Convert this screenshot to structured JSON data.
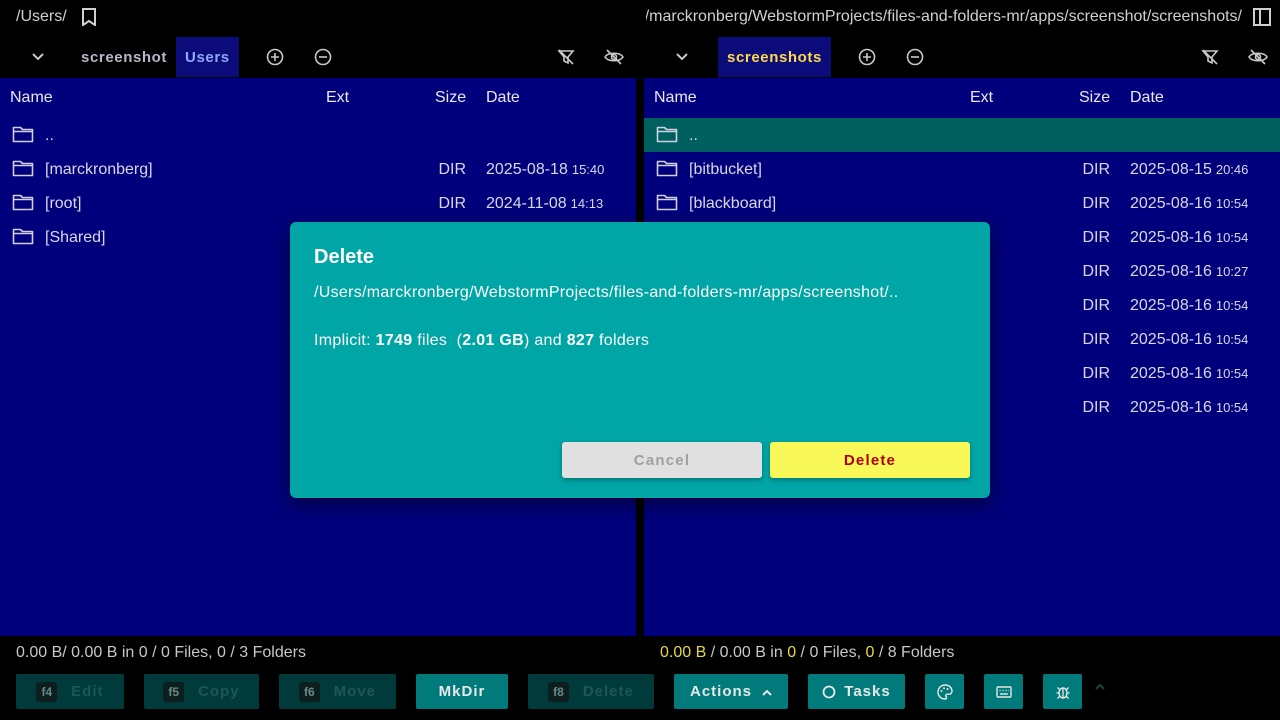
{
  "left": {
    "path": "/Users/",
    "tabs": [
      {
        "label": "screenshot"
      },
      {
        "label": "Users"
      }
    ],
    "columns": {
      "name": "Name",
      "ext": "Ext",
      "size": "Size",
      "date": "Date"
    },
    "rows": [
      {
        "name": "..",
        "size": "",
        "date": "",
        "time": ""
      },
      {
        "name": "[marckronberg]",
        "size": "DIR",
        "date": "2025-08-18",
        "time": "15:40"
      },
      {
        "name": "[root]",
        "size": "DIR",
        "date": "2024-11-08",
        "time": "14:13"
      },
      {
        "name": "[Shared]",
        "size": "",
        "date": "",
        "time": ""
      }
    ],
    "status": {
      "size": "0.00 B",
      "total": "/ 0.00 B",
      "in": " in ",
      "files_sel": "0",
      "files": " / 0 Files, ",
      "folders_sel": "0",
      "folders": " / 3 Folders"
    }
  },
  "right": {
    "path": "/Users/marckronberg/WebstormProjects/files-and-folders-mr/apps/screenshot/screenshots/",
    "tabs": [
      {
        "label": "screenshots"
      }
    ],
    "columns": {
      "name": "Name",
      "ext": "Ext",
      "size": "Size",
      "date": "Date"
    },
    "rows": [
      {
        "name": "..",
        "size": "",
        "date": "",
        "time": ""
      },
      {
        "name": "[bitbucket]",
        "size": "DIR",
        "date": "2025-08-15",
        "time": "20:46"
      },
      {
        "name": "[blackboard]",
        "size": "DIR",
        "date": "2025-08-16",
        "time": "10:54"
      },
      {
        "name": "",
        "size": "DIR",
        "date": "2025-08-16",
        "time": "10:54"
      },
      {
        "name": "",
        "size": "DIR",
        "date": "2025-08-16",
        "time": "10:27"
      },
      {
        "name": "",
        "size": "DIR",
        "date": "2025-08-16",
        "time": "10:54"
      },
      {
        "name": "",
        "size": "DIR",
        "date": "2025-08-16",
        "time": "10:54"
      },
      {
        "name": "",
        "size": "DIR",
        "date": "2025-08-16",
        "time": "10:54"
      },
      {
        "name": "",
        "size": "DIR",
        "date": "2025-08-16",
        "time": "10:54"
      }
    ],
    "status": {
      "size": "0.00 B",
      "total": " / 0.00 B",
      "in": " in ",
      "files_sel": "0",
      "files": " / 0 Files, ",
      "folders_sel": "0",
      "folders": " / 8 Folders"
    }
  },
  "toolbar": {
    "edit": {
      "key": "f4",
      "label": "Edit"
    },
    "copy": {
      "key": "f5",
      "label": "Copy"
    },
    "move": {
      "key": "f6",
      "label": "Move"
    },
    "mkdir": {
      "label": "MkDir"
    },
    "delete": {
      "key": "f8",
      "label": "Delete"
    },
    "actions": {
      "label": "Actions"
    },
    "tasks": {
      "label": "Tasks"
    }
  },
  "dialog": {
    "title": "Delete",
    "path": "/Users/marckronberg/WebstormProjects/files-and-folders-mr/apps/screenshot/..",
    "info_prefix": "Implicit: ",
    "files_count": "1749",
    "files_word": " files  (",
    "size": "2.01 GB",
    "and_word": ") and ",
    "folders_count": "827",
    "folders_word": " folders",
    "cancel_label": "Cancel",
    "delete_label": "Delete"
  },
  "colors": {
    "panel": "#00007c",
    "accent": "#007a7a",
    "dialog": "#00a5a5",
    "highlight": "#e6d84a",
    "delete_btn": "#f8f858"
  }
}
